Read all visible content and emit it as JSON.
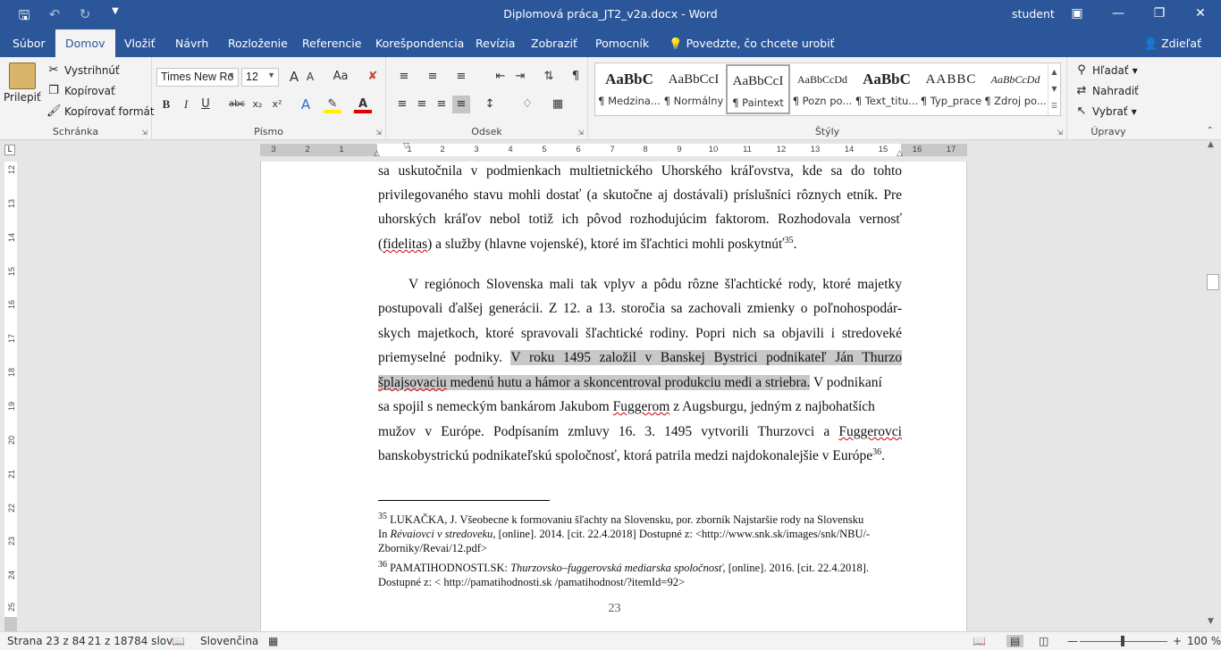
{
  "window": {
    "title": "Diplomová práca_JT2_v2a.docx - Word",
    "user": "student",
    "qat": {
      "save_icon": "save-icon",
      "undo_icon": "undo-icon",
      "redo_icon": "redo-icon",
      "customize_icon": "customize-icon"
    }
  },
  "tabs": [
    "Súbor",
    "Domov",
    "Vložiť",
    "Návrh",
    "Rozloženie",
    "Referencie",
    "Korešpondencia",
    "Revízia",
    "Zobraziť",
    "Pomocník"
  ],
  "active_tab": "Domov",
  "tell_me": "Povedzte, čo chcete urobiť",
  "share": "Zdieľať",
  "ribbon": {
    "clipboard": {
      "label": "Schránka",
      "paste": "Prilepiť",
      "cut": "Vystrihnúť",
      "copy": "Kopírovať",
      "format_painter": "Kopírovať formát"
    },
    "font": {
      "label": "Písmo",
      "font_name": "Times New Ro",
      "font_size": "12",
      "bold": "B",
      "italic": "I",
      "underline": "U",
      "strike": "abc",
      "subscript": "x₂",
      "superscript": "x²",
      "change_case": "Aa",
      "grow": "A",
      "shrink": "A"
    },
    "paragraph": {
      "label": "Odsek"
    },
    "styles": {
      "label": "Štýly",
      "items": [
        {
          "sample": "AaBbC",
          "name": "¶ Medzina..."
        },
        {
          "sample": "AaBbCcI",
          "name": "¶ Normálny"
        },
        {
          "sample": "AaBbCcI",
          "name": "¶ Paintext"
        },
        {
          "sample": "AaBbCcDd",
          "name": "¶ Pozn po..."
        },
        {
          "sample": "AaBbC",
          "name": "¶ Text_titu..."
        },
        {
          "sample": "AABBC",
          "name": "¶ Typ_prace"
        },
        {
          "sample": "AaBbCcDd",
          "name": "¶ Zdroj po..."
        }
      ]
    },
    "editing": {
      "label": "Úpravy",
      "find": "Hľadať",
      "replace": "Nahradiť",
      "select": "Vybrať"
    }
  },
  "ruler": {
    "left_numbers": [
      "3",
      "2",
      "1"
    ],
    "right_numbers": [
      "1",
      "2",
      "3",
      "4",
      "5",
      "6",
      "7",
      "8",
      "9",
      "10",
      "11",
      "12",
      "13",
      "14",
      "15",
      "16",
      "17"
    ],
    "vertical_numbers": [
      "12",
      "13",
      "14",
      "15",
      "16",
      "17",
      "18",
      "19",
      "20",
      "21",
      "22",
      "23",
      "24",
      "25"
    ]
  },
  "document": {
    "p1": {
      "l1": "sa uskutočnila v podmienkach multietnického Uhorského kráľovstva, kde sa do tohto",
      "l2": "privilegovaného stavu mohli dostať (a skutočne aj dostávali) príslušníci rôznych etník. Pre",
      "l3": "uhorských kráľov nebol totiž ich pôvod rozhodujúcim faktorom. Rozhodovala vernosť",
      "l4_a": "(",
      "l4_b": "fidelitas",
      "l4_c": ") a služby (hlavne vojenské), ktoré im šľachtici mohli poskytnúť",
      "l4_sup": "35",
      "l4_d": "."
    },
    "p2": {
      "l1": "V regiónoch Slovenska mali tak vplyv a pôdu rôzne šľachtické rody, ktoré majetky",
      "l2": "postupovali ďalšej generácii. Z 12. a 13. storočia sa zachovali zmienky o poľnohospodár-",
      "l3": "skych majetkoch, ktoré spravovali šľachtické rodiny. Popri nich sa objavili i stredoveké",
      "l4_a": "priemyselné podniky. ",
      "l4_hl": "V roku 1495 založil v Banskej Bystrici podnikateľ Ján Thurzo",
      "l5_hl_wavy": "šplajsovaciu",
      "l5_hl": " medenú hutu a hámor a skoncentroval produkciu medi a striebra.",
      "l5_b": " V podnikaní",
      "l6_a": "sa spojil s nemeckým bankárom Jakubom ",
      "l6_wavy": "Fuggerom",
      "l6_b": " z Augsburgu, jedným z najbohatších",
      "l7_a": "mužov v Európe. Podpísaním zmluvy 16. 3. 1495 vytvorili Thurzovci a ",
      "l7_wavy": "Fuggerovci",
      "l8": "banskobystrickú podnikateľskú spoločnosť, ktorá patrila medzi najdokonalejšie v Európe",
      "l8_sup": "36",
      "l8_end": "."
    },
    "footnotes": {
      "fn1_num": "35",
      "fn1_l1": " LUKAČKA, J. Všeobecne k formovaniu šľachty na Slovensku, por. zborník Najstaršie rody na Slovensku",
      "fn1_l2_a": "In ",
      "fn1_l2_i": "Révaiovci v stredoveku",
      "fn1_l2_b": ", [online]. 2014. [cit. 22.4.2018] Dostupné z: <http://www.snk.sk/images/snk/NBU/-",
      "fn1_l3": "Zborniky/Revai/12.pdf>",
      "fn2_num": "36",
      "fn2_l1_a": " PAMATIHODNOSTI.SK: ",
      "fn2_l1_i": "Thurzovsko–fuggerovská mediarska spoločnosť,",
      "fn2_l1_b": " [online]. 2016. [cit. 22.4.2018].",
      "fn2_l2": "Dostupné z: < http://pamatihodnosti.sk /pamatihodnost/?itemId=92>"
    },
    "page_number": "23"
  },
  "status": {
    "page": "Strana 23 z 84",
    "words": "21 z 18784 slov",
    "language": "Slovenčina",
    "zoom": "100 %"
  }
}
